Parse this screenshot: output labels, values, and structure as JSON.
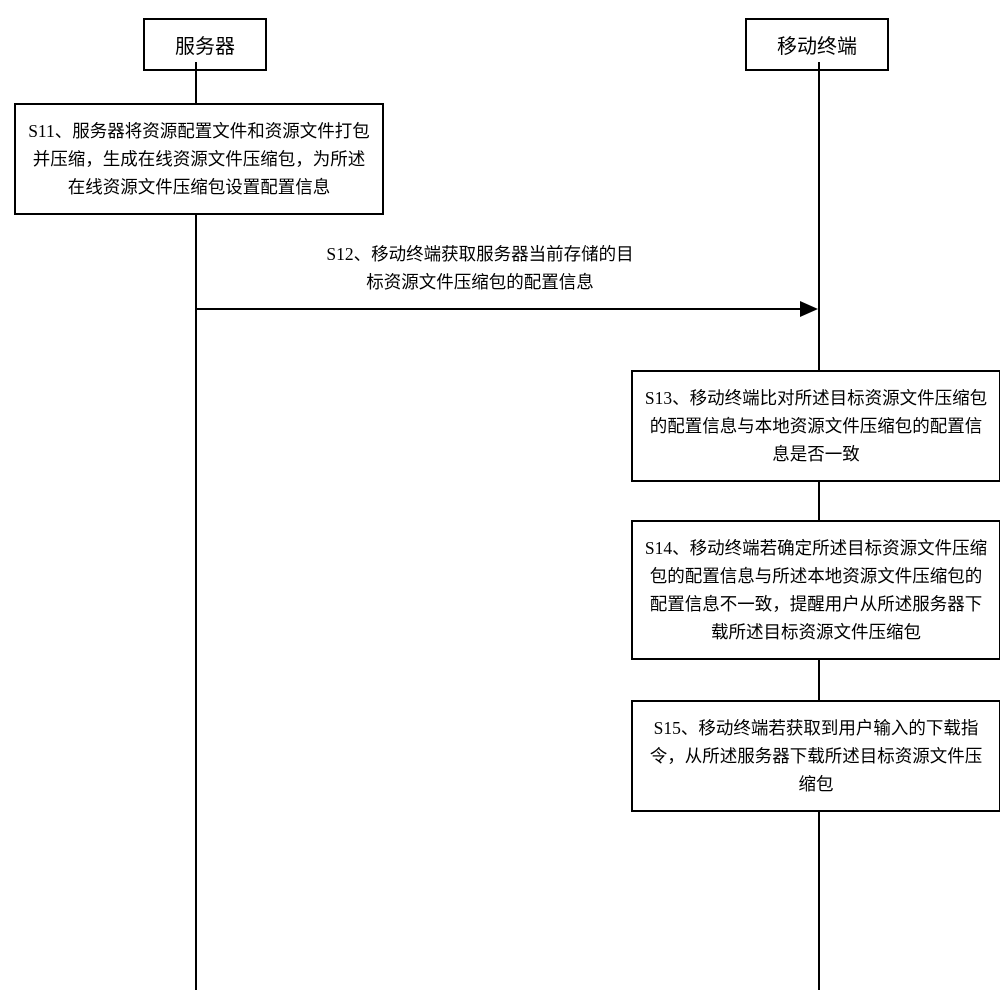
{
  "participants": {
    "server": "服务器",
    "mobile": "移动终端"
  },
  "steps": {
    "s11": "S11、服务器将资源配置文件和资源文件打包并压缩，生成在线资源文件压缩包，为所述在线资源文件压缩包设置配置信息",
    "s12_line1": "S12、移动终端获取服务器当前存储的目",
    "s12_line2": "标资源文件压缩包的配置信息",
    "s13": "S13、移动终端比对所述目标资源文件压缩包的配置信息与本地资源文件压缩包的配置信息是否一致",
    "s14": "S14、移动终端若确定所述目标资源文件压缩包的配置信息与所述本地资源文件压缩包的配置信息不一致，提醒用户从所述服务器下载所述目标资源文件压缩包",
    "s15": "S15、移动终端若获取到用户输入的下载指令，从所述服务器下载所述目标资源文件压缩包"
  },
  "chart_data": {
    "type": "sequence-diagram",
    "participants": [
      "服务器",
      "移动终端"
    ],
    "messages": [
      {
        "from": "服务器",
        "to": "服务器",
        "kind": "self-action",
        "label": "S11、服务器将资源配置文件和资源文件打包并压缩，生成在线资源文件压缩包，为所述在线资源文件压缩包设置配置信息"
      },
      {
        "from": "服务器",
        "to": "移动终端",
        "kind": "message",
        "label": "S12、移动终端获取服务器当前存储的目标资源文件压缩包的配置信息"
      },
      {
        "from": "移动终端",
        "to": "移动终端",
        "kind": "self-action",
        "label": "S13、移动终端比对所述目标资源文件压缩包的配置信息与本地资源文件压缩包的配置信息是否一致"
      },
      {
        "from": "移动终端",
        "to": "移动终端",
        "kind": "self-action",
        "label": "S14、移动终端若确定所述目标资源文件压缩包的配置信息与所述本地资源文件压缩包的配置信息不一致，提醒用户从所述服务器下载所述目标资源文件压缩包"
      },
      {
        "from": "移动终端",
        "to": "移动终端",
        "kind": "self-action",
        "label": "S15、移动终端若获取到用户输入的下载指令，从所述服务器下载所述目标资源文件压缩包"
      }
    ]
  }
}
